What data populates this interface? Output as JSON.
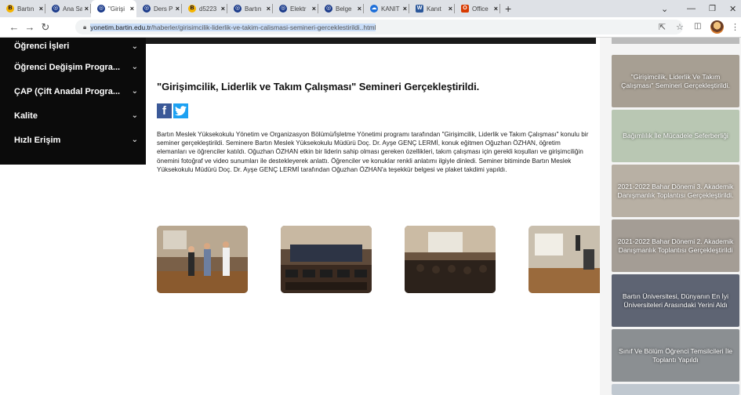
{
  "browser": {
    "tabs": [
      {
        "title": "Bartın",
        "favicon": "bartin",
        "active": false
      },
      {
        "title": "Ana Sa",
        "favicon": "globe",
        "active": false
      },
      {
        "title": "\"Girişi",
        "favicon": "globe",
        "active": true
      },
      {
        "title": "Ders P",
        "favicon": "globe",
        "active": false
      },
      {
        "title": "d5223",
        "favicon": "bartin",
        "active": false
      },
      {
        "title": "Bartın",
        "favicon": "globe",
        "active": false
      },
      {
        "title": "Elektr",
        "favicon": "globe",
        "active": false
      },
      {
        "title": "Belge",
        "favicon": "globe",
        "active": false
      },
      {
        "title": "KANIT",
        "favicon": "cloud",
        "active": false
      },
      {
        "title": "Kanıt",
        "favicon": "word",
        "active": false
      },
      {
        "title": "Office",
        "favicon": "office",
        "active": false
      }
    ],
    "new_tab_glyph": "+",
    "url_host": "yonetim.bartin.edu.tr",
    "url_path": "/haberler/girisimcilik-liderlik-ve-takim-calismasi-semineri-gerceklestirildi..html"
  },
  "sidebar": {
    "items": [
      {
        "label": "Öğrenci İşleri"
      },
      {
        "label": "Öğrenci Değişim Progra..."
      },
      {
        "label": "ÇAP (Çift Anadal Progra..."
      },
      {
        "label": "Kalite"
      },
      {
        "label": "Hızlı Erişim"
      }
    ]
  },
  "article": {
    "title": "\"Girişimcilik, Liderlik ve Takım Çalışması\" Semineri Gerçekleştirildi.",
    "share": {
      "facebook": "f"
    },
    "body": "Bartın Meslek Yüksekokulu Yönetim ve Organizasyon Bölümü/İşletme Yönetimi programı tarafından \"Girişimcilik, Liderlik ve Takım Çalışması\" konulu bir seminer gerçekleştirildi. Seminere Bartın Meslek Yüksekokulu Müdürü Doç. Dr. Ayşe GENÇ LERMİ, konuk eğitmen Oğuzhan ÖZHAN, öğretim elemanları ve öğrenciler katıldı. Oğuzhan ÖZHAN etkin bir liderin sahip olması gereken özellikleri, takım çalışması için gerekli koşulları ve girişimciliğin önemini fotoğraf ve video sunumları ile destekleyerek anlattı. Öğrenciler ve konuklar renkli anlatımı ilgiyle dinledi. Seminer bitiminde Bartın Meslek Yüksekokulu Müdürü Doç. Dr. Ayşe GENÇ LERMİ tarafından Oğuzhan ÖZHAN'a teşekkür belgesi ve plaket takdimi yapıldı."
  },
  "news": [
    {
      "title": "\"Girişimcilik, Liderlik Ve Takım Çalışması\" Semineri Gerçekleştirildi.",
      "color": "#a79f93"
    },
    {
      "title": "Bağımlılık İle Mücadele Seferberliği",
      "color": "#b9c7b3"
    },
    {
      "title": "2021-2022 Bahar Dönemi 3. Akademik Danışmanlık Toplantısı Gerçekleştirildi.",
      "color": "#b8b0a4"
    },
    {
      "title": "2021-2022 Bahar Dönemi 2. Akademik Danışmanlık Toplantısı Gerçekleştirildi",
      "color": "#a49d95"
    },
    {
      "title": "Bartın Üniversitesi, Dünyanın En İyi Üniversiteleri Arasındaki Yerini Aldı",
      "color": "#5e6473"
    },
    {
      "title": "Sınıf Ve Bölüm Öğrenci Temsilcileri İle Toplantı Yapıldı",
      "color": "#8b8f92"
    }
  ]
}
